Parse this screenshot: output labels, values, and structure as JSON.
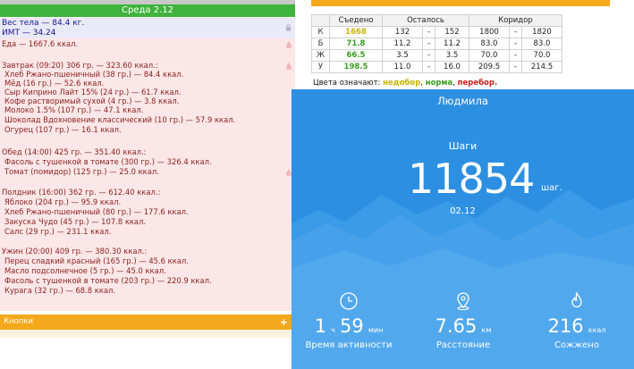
{
  "diary": {
    "day_title": "Среда 2.12",
    "weight": "Вес тела — 84.4 кг.",
    "bmi": "ИМТ — 34.24",
    "food_total": "Еда — 1667.6 ккал.",
    "meals": [
      {
        "header": "Завтрак (09:20) 306 гр. — 323.60 ккал.:",
        "items": [
          "Хлеб Ржано-пшеничный (38 гр.) — 84.4 ккал.",
          "Мёд (16 гр.) — 52.6 ккал.",
          "Сыр Киприно Лайт 15% (24 гр.) — 61.7 ккал.",
          "Кофе растворимый сухой (4 гр.) — 3.8 ккал.",
          "Молоко 1.5% (107 гр.) — 47.1 ккал.",
          "Шоколад Вдохновение классический (10 гр.) — 57.9 ккал.",
          "Огурец (107 гр.) — 16.1 ккал."
        ]
      },
      {
        "header": "Обед (14:00) 425 гр. — 351.40 ккал.:",
        "items": [
          "Фасоль с тушенкой в томате (300 гр.) — 326.4 ккал.",
          "Томат (помидор) (125 гр.) — 25.0 ккал."
        ]
      },
      {
        "header": "Полдник (16:00) 362 гр. — 612.40 ккал.:",
        "items": [
          "Яблоко (204 гр.) — 95.9 ккал.",
          "Хлеб Ржано-пшеничный (80 гр.) — 177.6 ккал.",
          "Закуска Чудо (45 гр.) — 107.8 ккал.",
          "Салс (29 гр.) — 231.1 ккал."
        ]
      },
      {
        "header": "Ужин (20:00) 409 гр. — 380.30 ккал.:",
        "items": [
          "Перец сладкий красный (165 гр.) — 45.6 ккал.",
          "Масло подсолнечное (5 гр.) — 45.0 ккал.",
          "Фасоль с тушенкой в томате (203 гр.) — 220.9 ккал.",
          "Курага (32 гр.) — 68.8 ккал."
        ]
      }
    ],
    "buttons_label": "Кнопки",
    "buttons_plus": "+"
  },
  "corridor": {
    "headers": {
      "eaten": "Съедено",
      "left": "Осталось",
      "corridor": "Коридор"
    },
    "rows": [
      {
        "k": "К",
        "eaten": "1668",
        "status": "low",
        "l1": "132",
        "l2": "152",
        "c1": "1800",
        "c2": "1820"
      },
      {
        "k": "Б",
        "eaten": "71.8",
        "status": "ok",
        "l1": "11.2",
        "l2": "11.2",
        "c1": "83.0",
        "c2": "83.0"
      },
      {
        "k": "Ж",
        "eaten": "66.5",
        "status": "ok",
        "l1": "3.5",
        "l2": "3.5",
        "c1": "70.0",
        "c2": "70.0"
      },
      {
        "k": "У",
        "eaten": "198.5",
        "status": "ok",
        "l1": "11.0",
        "l2": "16.0",
        "c1": "209.5",
        "c2": "214.5"
      }
    ],
    "dash": "-",
    "legend_prefix": "Цвета означают:",
    "legend_low": "недобор",
    "legend_ok": "норма",
    "legend_over": "перебор.",
    "colors": {
      "low": "#c8b400",
      "ok": "#3a9c22",
      "over": "#c81e1e"
    }
  },
  "steps_card": {
    "user_name": "Людмила",
    "steps_label": "Шаги",
    "steps_value": "11854",
    "steps_unit": "шаг.",
    "date": "02.12",
    "stats": [
      {
        "icon": "clock-icon",
        "value_main": "1",
        "value_unit1": "ч",
        "value_main2": "59",
        "value_unit2": "мин",
        "label": "Время активности"
      },
      {
        "icon": "location-icon",
        "value_main": "7.65",
        "value_unit1": "км",
        "label": "Расстояние"
      },
      {
        "icon": "flame-icon",
        "value_main": "216",
        "value_unit1": "ккал",
        "label": "Сожжено"
      }
    ],
    "colors": {
      "background": "#2c8fe2",
      "mountains": "#4aa3ea"
    }
  }
}
